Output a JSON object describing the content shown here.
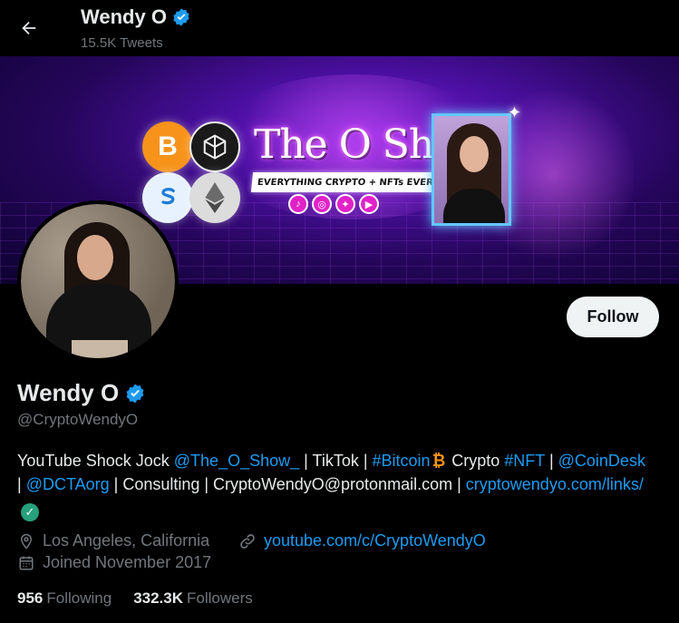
{
  "header": {
    "name": "Wendy O",
    "tweet_count": "15.5K Tweets"
  },
  "banner": {
    "title": "The O Show",
    "tagline": "EVERYTHING CRYPTO + NFTs EVERYDAY",
    "coin_btc": "B"
  },
  "profile": {
    "name": "Wendy O",
    "handle": "@CryptoWendyO",
    "follow_label": "Follow",
    "bio": {
      "t1": "YouTube Shock Jock ",
      "l1": "@The_O_Show_",
      "t2": " | TikTok | ",
      "l2": "#Bitcoin",
      "btc": "₿",
      "t3": " Crypto ",
      "l3": "#NFT",
      "t4": " | ",
      "l4": "@CoinDesk",
      "t5": " | ",
      "l5": "@DCTAorg",
      "t6": " | Consulting | CryptoWendyO@protonmail.com | ",
      "l6": "cryptowendyo.com/links/"
    },
    "location": "Los Angeles, California",
    "website": "youtube.com/c/CryptoWendyO",
    "joined": "Joined November 2017",
    "following_count": "956",
    "following_label": "Following",
    "followers_count": "332.3K",
    "followers_label": "Followers"
  },
  "colors": {
    "link": "#1d9bf0",
    "verified": "#1d9bf0",
    "muted": "#71767b"
  },
  "icons": {
    "back": "arrow-left-icon",
    "verified": "verified-badge-icon",
    "location": "location-pin-icon",
    "link": "link-icon",
    "calendar": "calendar-icon"
  }
}
